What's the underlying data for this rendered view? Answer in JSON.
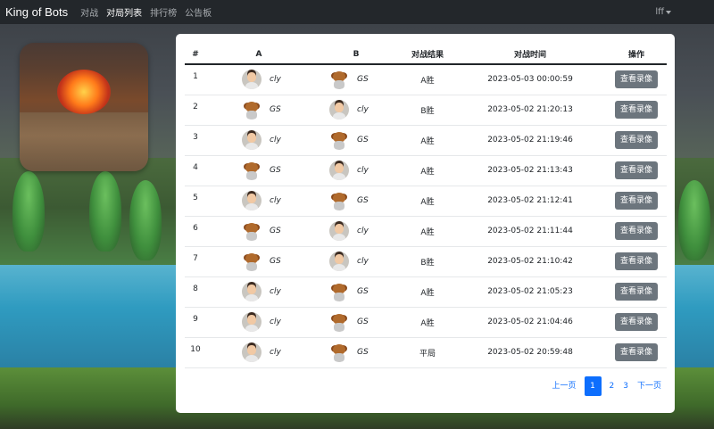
{
  "navbar": {
    "brand": "King of Bots",
    "items": [
      {
        "label": "对战",
        "active": false
      },
      {
        "label": "对局列表",
        "active": true
      },
      {
        "label": "排行榜",
        "active": false
      },
      {
        "label": "公告板",
        "active": false
      }
    ],
    "user": "lff"
  },
  "table": {
    "headers": [
      "#",
      "A",
      "B",
      "对战结果",
      "对战时间",
      "操作"
    ],
    "replay_label": "查看录像",
    "rows": [
      {
        "num": "1",
        "a_name": "cly",
        "a_avatar": "man-avatar",
        "b_name": "GS",
        "b_avatar": "bear-avatar",
        "result": "A胜",
        "time": "2023-05-03 00:00:59"
      },
      {
        "num": "2",
        "a_name": "GS",
        "a_avatar": "bear-avatar",
        "b_name": "cly",
        "b_avatar": "man-avatar",
        "result": "B胜",
        "time": "2023-05-02 21:20:13"
      },
      {
        "num": "3",
        "a_name": "cly",
        "a_avatar": "man-avatar",
        "b_name": "GS",
        "b_avatar": "bear-avatar",
        "result": "A胜",
        "time": "2023-05-02 21:19:46"
      },
      {
        "num": "4",
        "a_name": "GS",
        "a_avatar": "bear-avatar",
        "b_name": "cly",
        "b_avatar": "man-avatar",
        "result": "A胜",
        "time": "2023-05-02 21:13:43"
      },
      {
        "num": "5",
        "a_name": "cly",
        "a_avatar": "man-avatar",
        "b_name": "GS",
        "b_avatar": "bear-avatar",
        "result": "A胜",
        "time": "2023-05-02 21:12:41"
      },
      {
        "num": "6",
        "a_name": "GS",
        "a_avatar": "bear-avatar",
        "b_name": "cly",
        "b_avatar": "man-avatar",
        "result": "A胜",
        "time": "2023-05-02 21:11:44"
      },
      {
        "num": "7",
        "a_name": "GS",
        "a_avatar": "bear-avatar",
        "b_name": "cly",
        "b_avatar": "man-avatar",
        "result": "B胜",
        "time": "2023-05-02 21:10:42"
      },
      {
        "num": "8",
        "a_name": "cly",
        "a_avatar": "man-avatar",
        "b_name": "GS",
        "b_avatar": "bear-avatar",
        "result": "A胜",
        "time": "2023-05-02 21:05:23"
      },
      {
        "num": "9",
        "a_name": "cly",
        "a_avatar": "man-avatar",
        "b_name": "GS",
        "b_avatar": "bear-avatar",
        "result": "A胜",
        "time": "2023-05-02 21:04:46"
      },
      {
        "num": "10",
        "a_name": "cly",
        "a_avatar": "man-avatar",
        "b_name": "GS",
        "b_avatar": "bear-avatar",
        "result": "平局",
        "time": "2023-05-02 20:59:48"
      }
    ]
  },
  "pagination": {
    "prev": "上一页",
    "pages": [
      "1",
      "2",
      "3"
    ],
    "current": "1",
    "next": "下一页"
  },
  "colors": {
    "navbar_bg": "#23272b",
    "replay_button": "#6c757d",
    "pagination_accent": "#0d6efd"
  }
}
